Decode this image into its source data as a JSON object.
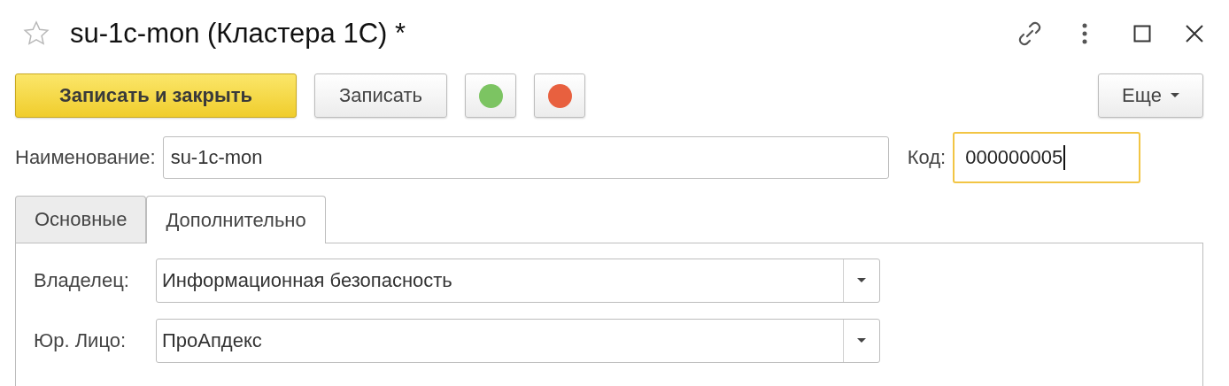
{
  "window": {
    "title": "su-1c-mon (Кластера 1С) *",
    "favorite": false
  },
  "toolbar": {
    "buttons": [
      {
        "kind": "primary",
        "label": "Записать и закрыть"
      },
      {
        "kind": "plain",
        "label": "Записать"
      },
      {
        "kind": "dot",
        "color": "#7cc462"
      },
      {
        "kind": "dot",
        "color": "#e8603f"
      }
    ],
    "more": "Еще"
  },
  "header_fields": [
    {
      "label": "Наименование:",
      "value": "su-1c-mon",
      "focused": false
    },
    {
      "label": "Код:",
      "value": "000000005",
      "focused": true
    }
  ],
  "tabs": [
    {
      "label": "Основные",
      "selected": false
    },
    {
      "label": "Дополнительно",
      "selected": true
    }
  ],
  "fields": [
    {
      "label": "Владелец:",
      "value": "Информационная безопасность"
    },
    {
      "label": "Юр. Лицо:",
      "value": "ПроАпдекс"
    }
  ]
}
